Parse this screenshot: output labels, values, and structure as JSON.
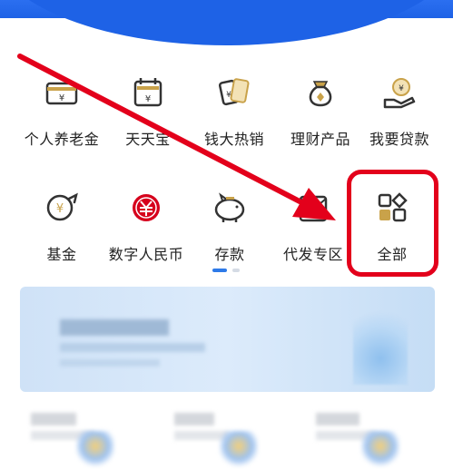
{
  "quick_menu": {
    "row1": [
      {
        "label": "个人养老金",
        "icon": "pension-card-icon"
      },
      {
        "label": "天天宝",
        "icon": "calendar-wallet-icon"
      },
      {
        "label": "钱大热销",
        "icon": "hot-sale-cards-icon"
      },
      {
        "label": "理财产品",
        "icon": "money-bag-icon"
      },
      {
        "label": "我要贷款",
        "icon": "loan-hand-coin-icon"
      }
    ],
    "row2": [
      {
        "label": "基金",
        "icon": "fund-coin-arrow-icon"
      },
      {
        "label": "数字人民币",
        "icon": "digital-rmb-icon"
      },
      {
        "label": "存款",
        "icon": "piggy-bank-icon"
      },
      {
        "label": "代发专区",
        "icon": "envelope-icon"
      },
      {
        "label": "全部",
        "icon": "all-apps-grid-icon"
      }
    ]
  },
  "pagination": {
    "pages": 2,
    "active": 1
  },
  "colors": {
    "brand_blue": "#1e62e6",
    "annotation_red": "#e3001b",
    "icon_gold": "#c9a24a",
    "icon_red": "#d6001c",
    "icon_dark": "#333333"
  }
}
